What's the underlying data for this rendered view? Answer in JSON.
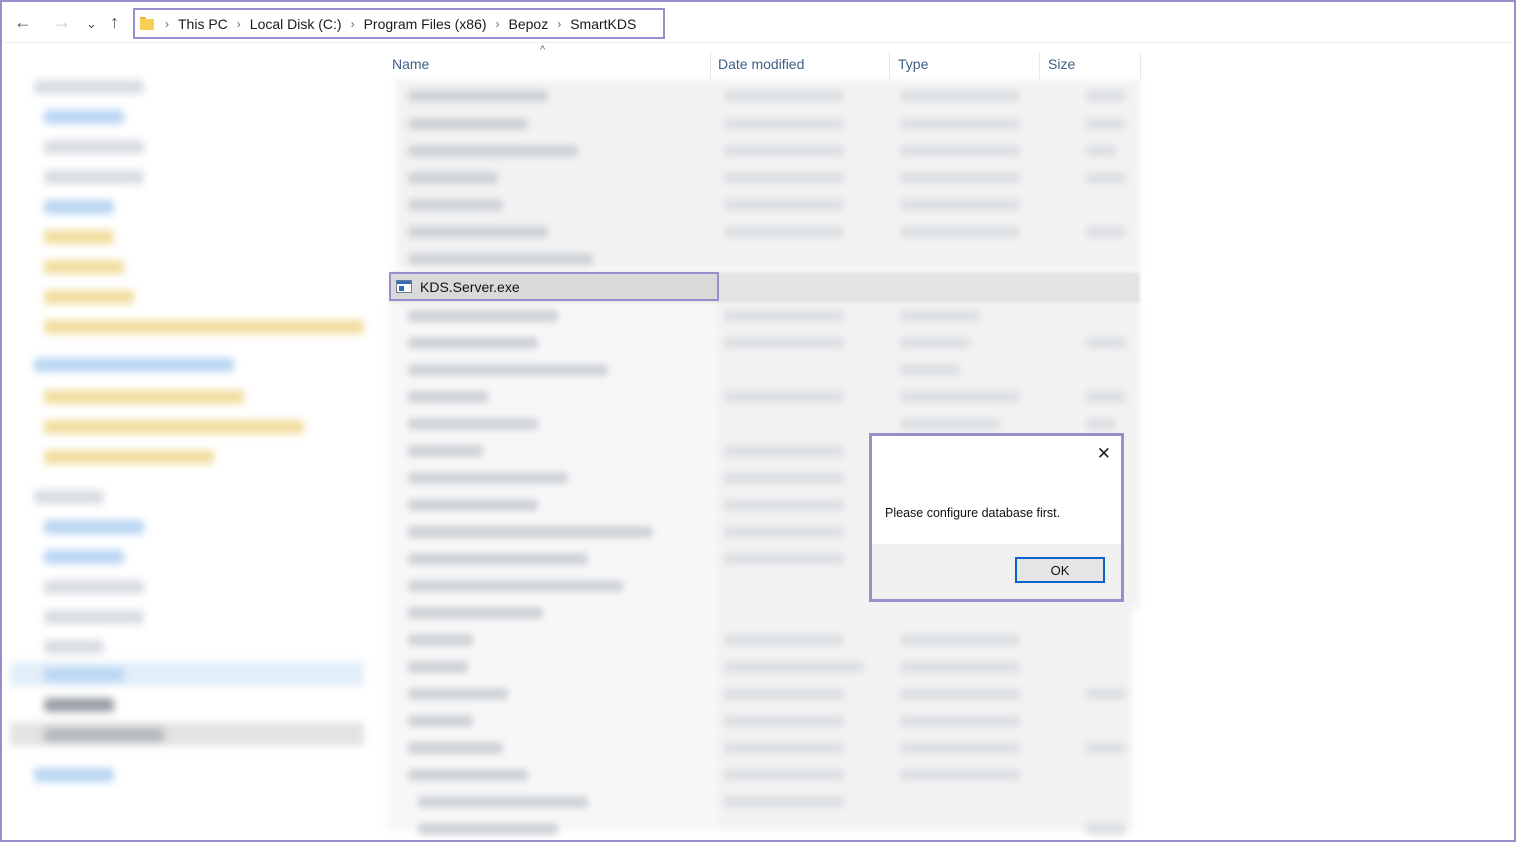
{
  "nav": {
    "back_icon": "←",
    "forward_icon": "→",
    "recent_icon": "⌄",
    "up_icon": "↑"
  },
  "breadcrumb": {
    "separator": "›",
    "items": [
      "This PC",
      "Local Disk (C:)",
      "Program Files (x86)",
      "Bepoz",
      "SmartKDS"
    ]
  },
  "columns": {
    "name": "Name",
    "date_modified": "Date modified",
    "type": "Type",
    "size": "Size",
    "sort_indicator": "^"
  },
  "selected_file": {
    "name": "KDS.Server.exe"
  },
  "dialog": {
    "close_glyph": "✕",
    "message": "Please configure database first.",
    "ok_label": "OK"
  },
  "colors": {
    "annotation_border": "#9b8ccc",
    "ok_focus": "#0a64c8",
    "header_text": "#3e5f86"
  }
}
